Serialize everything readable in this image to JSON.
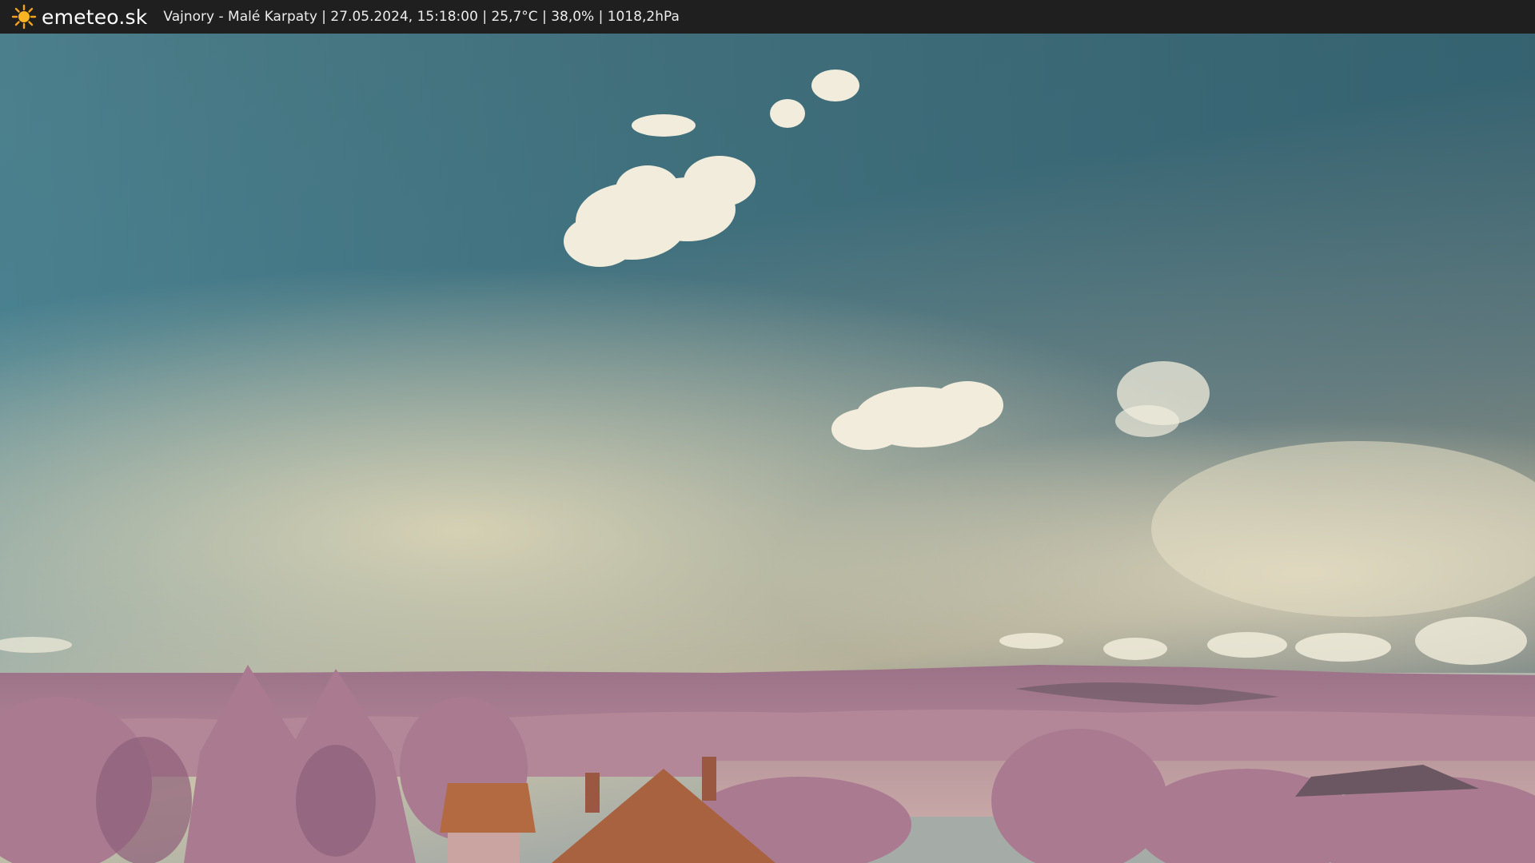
{
  "header": {
    "logo_icon": "sun-icon",
    "brand": "emeteo.sk",
    "info": "Vajnory - Malé Karpaty | 27.05.2024, 15:18:00 | 25,7°C | 38,0% | 1018,2hPa"
  },
  "colors": {
    "bar": "#1f1f1f",
    "sky_top": "#3e6f7c",
    "sky_haze": "#d8d3b8",
    "foliage": "#a8788f",
    "roof": "#b2673f"
  }
}
